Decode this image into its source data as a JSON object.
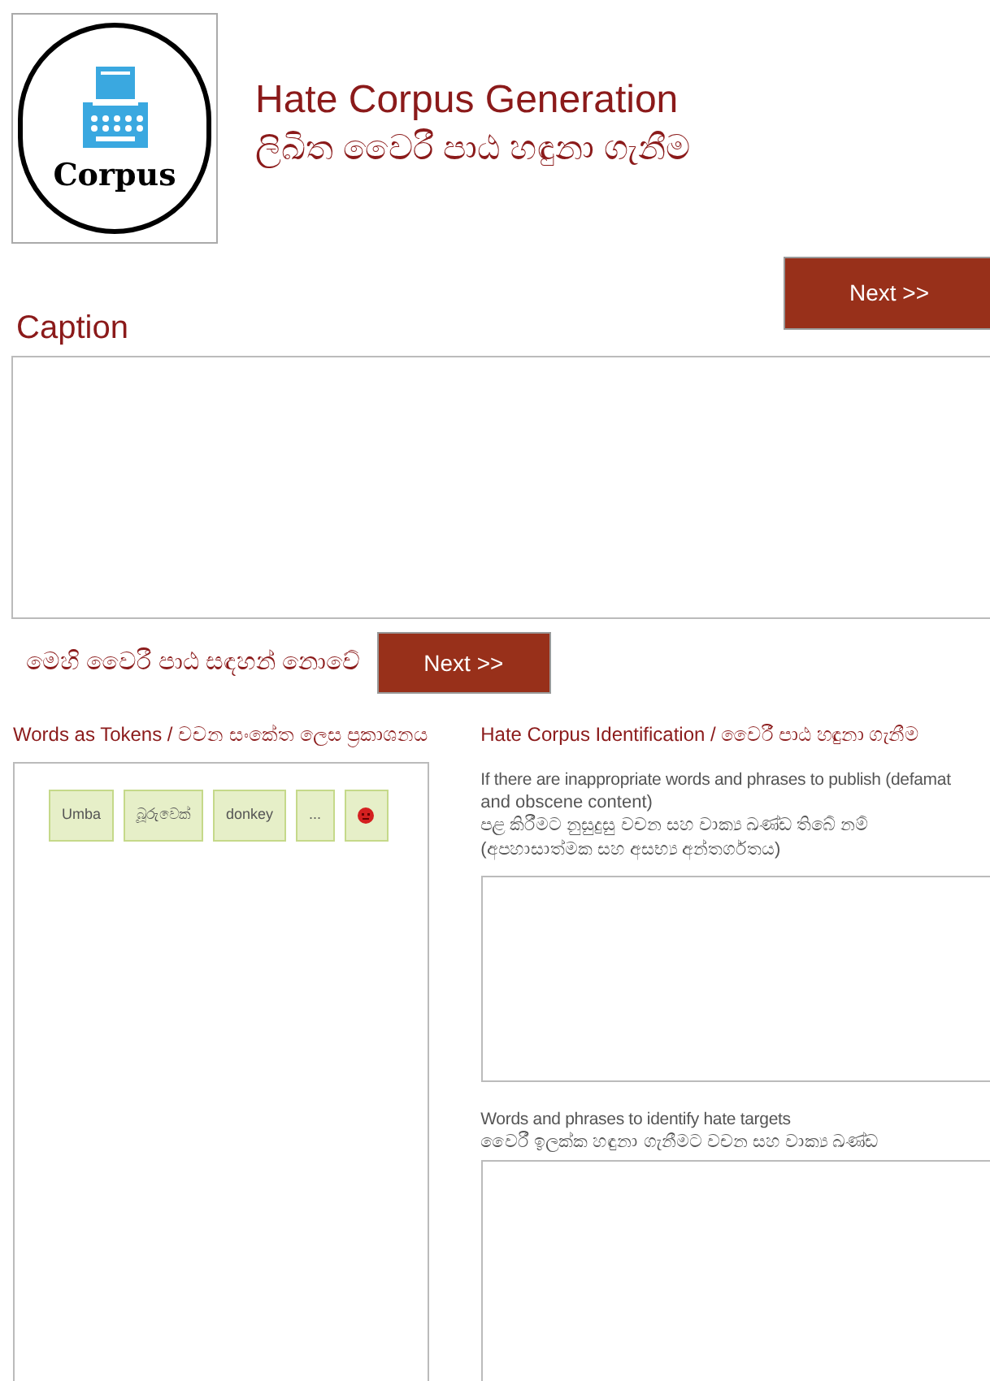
{
  "header": {
    "logo_text": "Corpus",
    "title": "Hate Corpus Generation",
    "subtitle": "ලිඛිත වෛරී පාඨ හඳුනා ගැනීම"
  },
  "top_next": {
    "label": "Next >>"
  },
  "caption": {
    "label": "Caption"
  },
  "no_hate": {
    "text": "මෙහි වෛරී පාඨ සඳහන් නොවේ",
    "button": "Next >>"
  },
  "tokens_panel": {
    "heading": "Words as Tokens / වචන සංකේත ලෙස ප්‍රකාශනය",
    "tokens": [
      {
        "kind": "text",
        "label": "Umba"
      },
      {
        "kind": "text",
        "label": "බූරුවෙක්"
      },
      {
        "kind": "text",
        "label": "donkey"
      },
      {
        "kind": "text",
        "label": "..."
      },
      {
        "kind": "icon"
      }
    ]
  },
  "identification": {
    "heading": "Hate Corpus Identification / වෛරී පාඨ හඳුනා ගැනීම",
    "fields": [
      {
        "label": "If there are inappropriate words and phrases to publish (defamat",
        "label_cont": "and obscene content)",
        "label_si": "පළ කිරීමට නුසුදුසු වචන සහ වාක්‍ය ඛණ්ඩ තිබේ නම්",
        "label_si_cont": "(අපහාසාත්මක සහ අසභ්‍ය අන්තර්ගතය)"
      },
      {
        "label": "Words and phrases to identify hate targets",
        "label_si": "වෛරී ඉලක්ක හඳුනා ගැනීමට වචන සහ වාක්‍ය ඛණ්ඩ"
      }
    ]
  }
}
